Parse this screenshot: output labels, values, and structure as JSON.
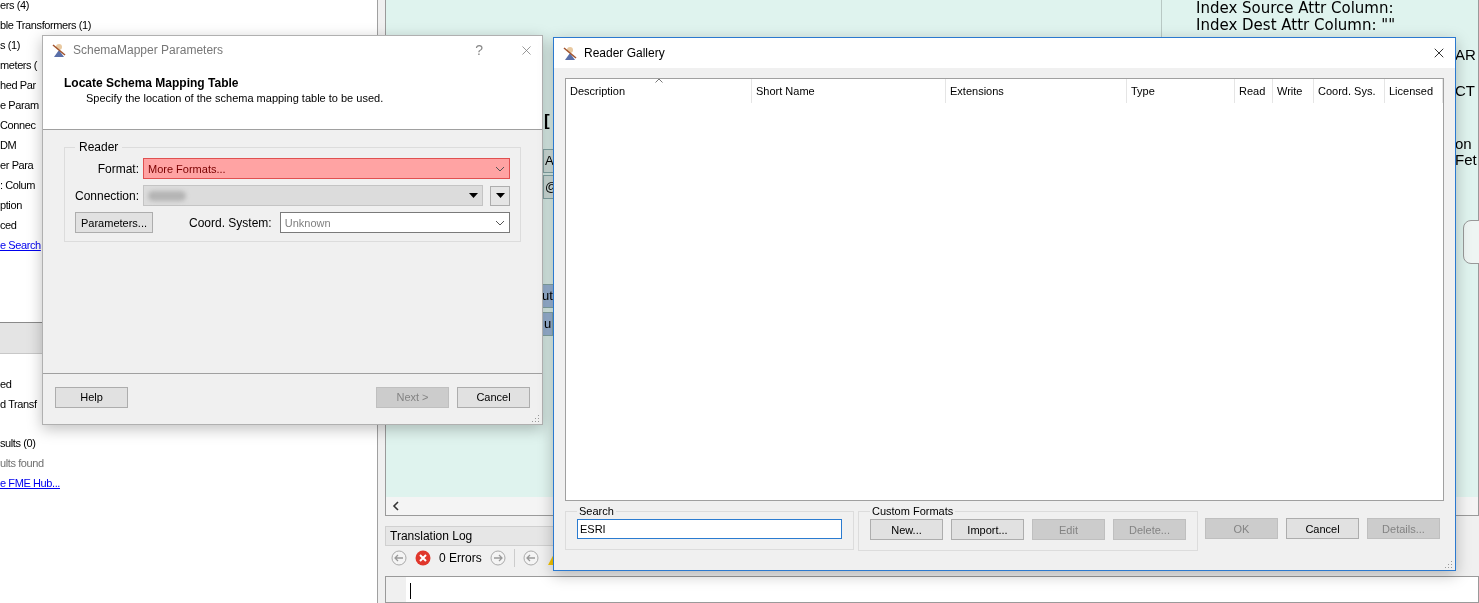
{
  "explorer": {
    "items": [
      {
        "label": "ers (4)",
        "kind": "text"
      },
      {
        "label": "ble Transformers (1)",
        "kind": "text"
      },
      {
        "label": "s (1)",
        "kind": "text"
      },
      {
        "label": "meters (",
        "kind": "text"
      },
      {
        "label": "hed Par",
        "kind": "text"
      },
      {
        "label": "e Param",
        "kind": "text"
      },
      {
        "label": "Connec",
        "kind": "text"
      },
      {
        "label": "DM",
        "kind": "text"
      },
      {
        "label": "er Para",
        "kind": "text"
      },
      {
        "label": ": Colum",
        "kind": "text"
      },
      {
        "label": "ption",
        "kind": "text"
      },
      {
        "label": "ced",
        "kind": "text"
      },
      {
        "label": "e Search",
        "kind": "link"
      }
    ],
    "lower_items": [
      {
        "label": "ed",
        "kind": "text"
      },
      {
        "label": "d Transf",
        "kind": "text"
      }
    ],
    "search_results": [
      {
        "label": "sults (0)",
        "kind": "text"
      },
      {
        "label": "ults found",
        "kind": "muted"
      },
      {
        "label": "e FME Hub...",
        "kind": "link"
      }
    ]
  },
  "canvas": {
    "annotation": [
      "Index Source Attr Column:",
      "Index Dest Attr Column: \"\""
    ],
    "fragments": [
      {
        "text": "[",
        "kind": "heading"
      },
      {
        "text": "A",
        "kind": "cell"
      },
      {
        "text": "@",
        "kind": "cell"
      },
      {
        "text": "ut",
        "kind": "port"
      },
      {
        "text": "u",
        "kind": "port"
      }
    ],
    "edge_texts": [
      "AR",
      "CT",
      "on",
      "Fet"
    ]
  },
  "translation_log": {
    "title": "Translation Log",
    "errors": "0 Errors"
  },
  "schema_dialog": {
    "title": "SchemaMapper Parameters",
    "help_glyph": "?",
    "heading": "Locate Schema Mapping Table",
    "subtitle": "Specify the location of the schema mapping table to be used.",
    "group": "Reader",
    "format": {
      "label": "Format:",
      "value": "More Formats...",
      "invalid": true
    },
    "connection": {
      "label": "Connection:"
    },
    "parameters_button": "Parameters...",
    "coord": {
      "label": "Coord. System:",
      "placeholder": "Unknown"
    },
    "buttons": [
      {
        "label": "Help",
        "disabled": false
      },
      {
        "label": "Next >",
        "disabled": true
      },
      {
        "label": "Cancel",
        "disabled": false
      }
    ]
  },
  "reader_gallery": {
    "title": "Reader Gallery",
    "columns": [
      {
        "label": "Description",
        "sorted": true
      },
      {
        "label": "Short Name",
        "sorted": false
      },
      {
        "label": "Extensions",
        "sorted": false
      },
      {
        "label": "Type",
        "sorted": false
      },
      {
        "label": "Read",
        "sorted": false
      },
      {
        "label": "Write",
        "sorted": false
      },
      {
        "label": "Coord. Sys.",
        "sorted": false
      },
      {
        "label": "Licensed",
        "sorted": false
      }
    ],
    "search": {
      "label": "Search",
      "value": "ESRI",
      "focused": true
    },
    "custom_formats": {
      "label": "Custom Formats",
      "buttons": [
        {
          "label": "New...",
          "disabled": false
        },
        {
          "label": "Import...",
          "disabled": false
        },
        {
          "label": "Edit",
          "disabled": true
        },
        {
          "label": "Delete...",
          "disabled": true
        }
      ]
    },
    "buttons": [
      {
        "label": "OK",
        "disabled": true
      },
      {
        "label": "Cancel",
        "disabled": false
      },
      {
        "label": "Details...",
        "disabled": true
      }
    ]
  }
}
